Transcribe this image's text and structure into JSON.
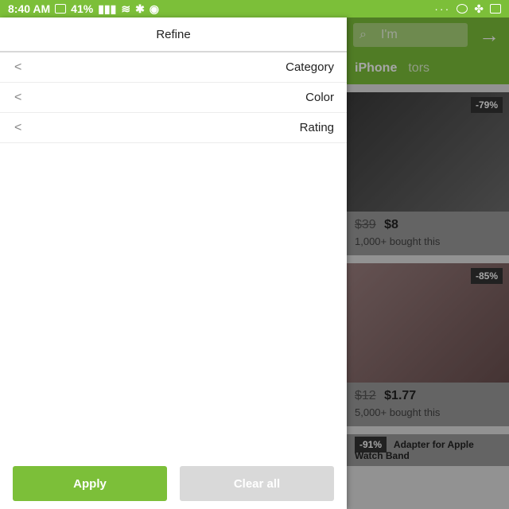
{
  "status_bar": {
    "time": "8:40 AM",
    "battery": "41%",
    "dots": "···"
  },
  "drawer": {
    "title": "Refine",
    "rows": [
      {
        "label": "Category"
      },
      {
        "label": "Color"
      },
      {
        "label": "Rating"
      }
    ],
    "apply_label": "Apply",
    "clear_label": "Clear all"
  },
  "background_app": {
    "search_placeholder": "I'm",
    "tabs": [
      "iPhone",
      "tors"
    ],
    "products": [
      {
        "discount": "-79%",
        "old_price": "$39",
        "price": "$8",
        "sold": "1,000+ bought this"
      },
      {
        "discount": "-85%",
        "old_price": "$12",
        "price": "$1.77",
        "sold": "5,000+ bought this"
      },
      {
        "discount": "-91%",
        "title": "Adapter for Apple Watch Band"
      }
    ]
  },
  "colors": {
    "brand_green": "#7cbf39",
    "disabled_gray": "#d9d9d9"
  }
}
